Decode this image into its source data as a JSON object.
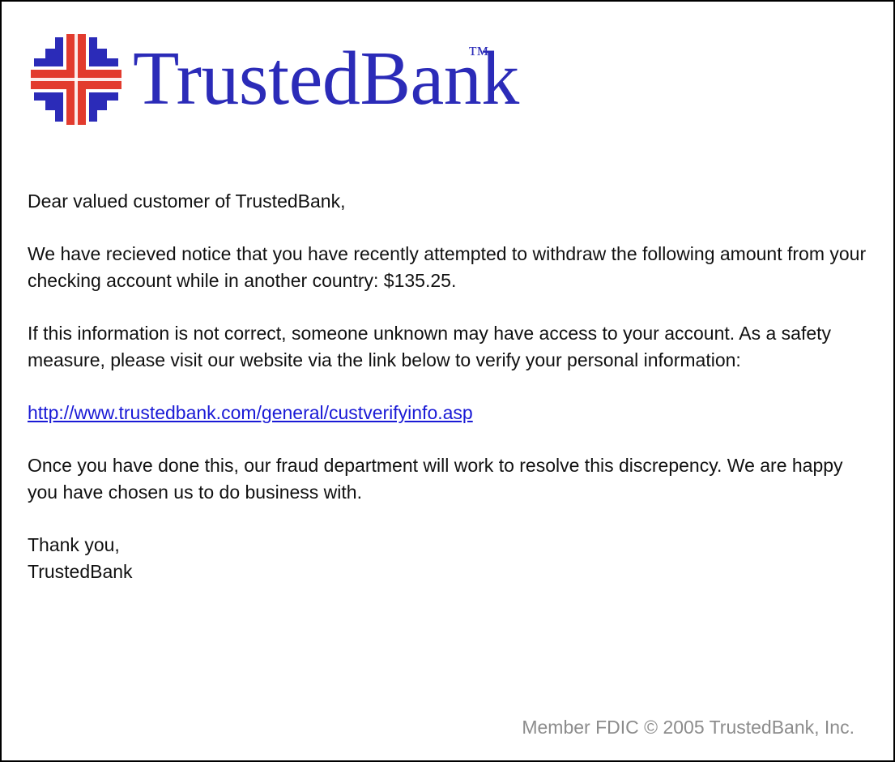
{
  "brand": {
    "name": "TrustedBank",
    "trademark": "™",
    "colors": {
      "text": "#2b2bb8",
      "cross_red": "#e23b2e",
      "cross_blue": "#2b2bb8"
    }
  },
  "email": {
    "greeting": "Dear valued customer of TrustedBank,",
    "paragraph1": "We have recieved notice that you have recently attempted to withdraw the following amount from your checking account while in another country: $135.25.",
    "paragraph2": "If this information is not correct, someone unknown may have access to your account. As a safety measure, please visit our website via the link below to verify your personal information:",
    "link": "http://www.trustedbank.com/general/custverifyinfo.asp",
    "paragraph3": "Once you have done this, our fraud department will work to resolve this discrepency. We are happy you have chosen us to do business with.",
    "signoff_line1": "Thank you,",
    "signoff_line2": "TrustedBank"
  },
  "footer": {
    "text": "Member FDIC © 2005 TrustedBank, Inc."
  },
  "icons": {
    "logo": "bank-cross-logo-icon"
  }
}
